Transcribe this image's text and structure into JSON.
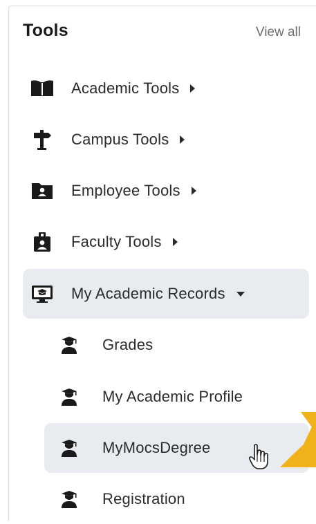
{
  "header": {
    "title": "Tools",
    "view_all": "View all"
  },
  "menu": [
    {
      "label": "Academic Tools",
      "icon": "book-icon",
      "expanded": false
    },
    {
      "label": "Campus Tools",
      "icon": "signpost-icon",
      "expanded": false
    },
    {
      "label": "Employee Tools",
      "icon": "folder-user-icon",
      "expanded": false
    },
    {
      "label": "Faculty Tools",
      "icon": "badge-icon",
      "expanded": false
    },
    {
      "label": "My Academic Records",
      "icon": "monitor-graduation-icon",
      "expanded": true
    }
  ],
  "submenu": [
    {
      "label": "Grades",
      "icon": "graduate-icon"
    },
    {
      "label": "My Academic Profile",
      "icon": "graduate-icon"
    },
    {
      "label": "MyMocsDegree",
      "icon": "graduate-icon",
      "hovered": true
    },
    {
      "label": "Registration",
      "icon": "graduate-icon"
    }
  ],
  "colors": {
    "active_bg": "#e8ebef",
    "annotation_arrow": "#f0b21a",
    "icon": "#1a1a1a"
  }
}
